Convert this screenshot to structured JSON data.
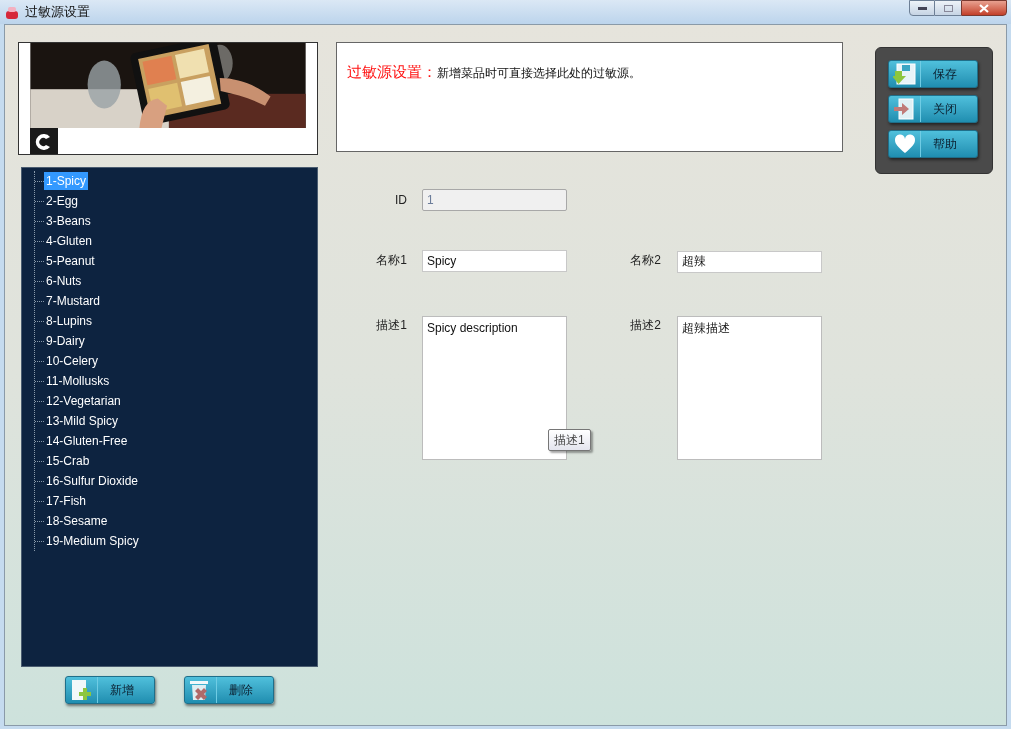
{
  "window": {
    "title": "过敏源设置"
  },
  "header": {
    "title": "过敏源设置：",
    "description": "新增菜品时可直接选择此处的过敏源。"
  },
  "toolbar": [
    {
      "label": "保存",
      "kind": "save"
    },
    {
      "label": "关闭",
      "kind": "close"
    },
    {
      "label": "帮助",
      "kind": "help"
    }
  ],
  "allergen_list": [
    {
      "label": "1-Spicy",
      "selected": true
    },
    {
      "label": "2-Egg",
      "selected": false
    },
    {
      "label": "3-Beans",
      "selected": false
    },
    {
      "label": "4-Gluten",
      "selected": false
    },
    {
      "label": "5-Peanut",
      "selected": false
    },
    {
      "label": "6-Nuts",
      "selected": false
    },
    {
      "label": "7-Mustard",
      "selected": false
    },
    {
      "label": "8-Lupins",
      "selected": false
    },
    {
      "label": "9-Dairy",
      "selected": false
    },
    {
      "label": "10-Celery",
      "selected": false
    },
    {
      "label": "11-Mollusks",
      "selected": false
    },
    {
      "label": "12-Vegetarian",
      "selected": false
    },
    {
      "label": "13-Mild Spicy",
      "selected": false
    },
    {
      "label": "14-Gluten-Free",
      "selected": false
    },
    {
      "label": "15-Crab",
      "selected": false
    },
    {
      "label": "16-Sulfur Dioxide",
      "selected": false
    },
    {
      "label": "17-Fish",
      "selected": false
    },
    {
      "label": "18-Sesame",
      "selected": false
    },
    {
      "label": "19-Medium Spicy",
      "selected": false
    }
  ],
  "list_buttons": [
    {
      "label": "新增",
      "kind": "add"
    },
    {
      "label": "删除",
      "kind": "delete"
    }
  ],
  "form": {
    "id": {
      "label": "ID",
      "value": "1",
      "disabled": true
    },
    "name1": {
      "label": "名称1",
      "value": "Spicy"
    },
    "name2": {
      "label": "名称2",
      "value": "超辣"
    },
    "description1": {
      "label": "描述1",
      "value": "Spicy description",
      "tooltip": "描述1"
    },
    "description2": {
      "label": "描述2",
      "value": "超辣描述"
    }
  }
}
